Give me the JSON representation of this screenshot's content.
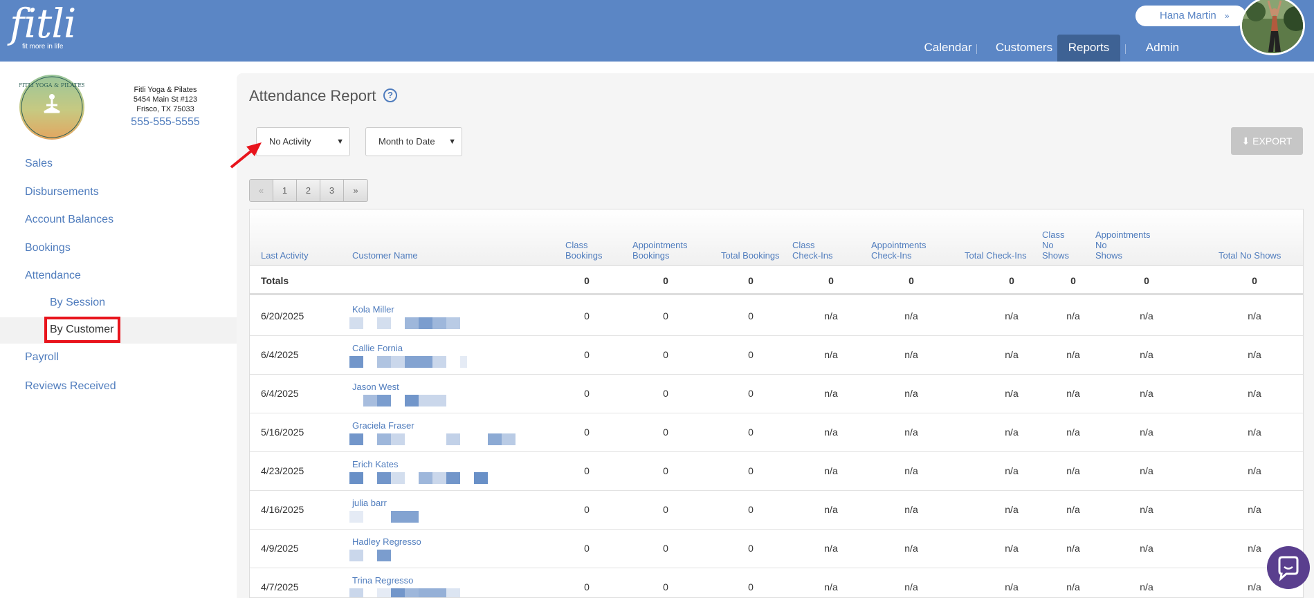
{
  "app": {
    "logo_text": "fitli",
    "logo_tagline": "fit more in life",
    "user_name": "Hana Martin",
    "user_chevron": "»"
  },
  "nav": {
    "items": [
      {
        "label": "Calendar"
      },
      {
        "label": "Customers"
      },
      {
        "label": "Reports",
        "active": true
      },
      {
        "label": "Admin"
      }
    ]
  },
  "studio": {
    "name": "Fitli Yoga & Pilates",
    "address1": "5454 Main St #123",
    "address2": "Frisco, TX 75033",
    "phone": "555-555-5555",
    "logo_text": "FITLI YOGA & PILATES"
  },
  "sidebar": {
    "items": [
      {
        "label": "Sales"
      },
      {
        "label": "Disbursements"
      },
      {
        "label": "Account Balances"
      },
      {
        "label": "Bookings"
      },
      {
        "label": "Attendance"
      },
      {
        "label": "Payroll"
      },
      {
        "label": "Reviews Received"
      }
    ],
    "subitems": [
      {
        "label": "By Session"
      },
      {
        "label": "By Customer",
        "active": true
      }
    ]
  },
  "report": {
    "title": "Attendance Report",
    "help_icon": "question-circle-icon",
    "filter_activity": "No Activity",
    "filter_range": "Month to Date",
    "export_label": "EXPORT",
    "pager": [
      "«",
      "1",
      "2",
      "3",
      "»"
    ]
  },
  "table": {
    "headers": [
      [
        "Last Activity"
      ],
      [
        "Customer Name"
      ],
      [
        "Class",
        "Bookings"
      ],
      [
        "Appointments",
        "Bookings"
      ],
      [
        "Total Bookings"
      ],
      [
        "Class",
        "Check-Ins"
      ],
      [
        "Appointments",
        "Check-Ins"
      ],
      [
        "Total Check-Ins"
      ],
      [
        "Class",
        "No",
        "Shows"
      ],
      [
        "Appointments",
        "No",
        "Shows"
      ],
      [
        "Total No Shows"
      ]
    ],
    "totals": {
      "label": "Totals",
      "values": [
        "0",
        "0",
        "0",
        "0",
        "0",
        "0",
        "0",
        "0",
        "0"
      ]
    },
    "rows": [
      {
        "date": "6/20/2025",
        "name": "Kola Miller",
        "values": [
          "0",
          "0",
          "0",
          "n/a",
          "n/a",
          "n/a",
          "n/a",
          "n/a",
          "n/a"
        ]
      },
      {
        "date": "6/4/2025",
        "name": "Callie Fornia",
        "values": [
          "0",
          "0",
          "0",
          "n/a",
          "n/a",
          "n/a",
          "n/a",
          "n/a",
          "n/a"
        ]
      },
      {
        "date": "6/4/2025",
        "name": "Jason West",
        "values": [
          "0",
          "0",
          "0",
          "n/a",
          "n/a",
          "n/a",
          "n/a",
          "n/a",
          "n/a"
        ]
      },
      {
        "date": "5/16/2025",
        "name": "Graciela Fraser",
        "values": [
          "0",
          "0",
          "0",
          "n/a",
          "n/a",
          "n/a",
          "n/a",
          "n/a",
          "n/a"
        ]
      },
      {
        "date": "4/23/2025",
        "name": "Erich Kates",
        "values": [
          "0",
          "0",
          "0",
          "n/a",
          "n/a",
          "n/a",
          "n/a",
          "n/a",
          "n/a"
        ]
      },
      {
        "date": "4/16/2025",
        "name": "julia barr",
        "values": [
          "0",
          "0",
          "0",
          "n/a",
          "n/a",
          "n/a",
          "n/a",
          "n/a",
          "n/a"
        ]
      },
      {
        "date": "4/9/2025",
        "name": "Hadley Regresso",
        "values": [
          "0",
          "0",
          "0",
          "n/a",
          "n/a",
          "n/a",
          "n/a",
          "n/a",
          "n/a"
        ]
      },
      {
        "date": "4/7/2025",
        "name": "Trina Regresso",
        "values": [
          "0",
          "0",
          "0",
          "n/a",
          "n/a",
          "n/a",
          "n/a",
          "n/a",
          "n/a"
        ]
      }
    ]
  },
  "colors": {
    "brand_blue": "#5b86c5",
    "link_blue": "#4f7cbd",
    "active_nav": "#3e6294",
    "highlight_red": "#e8141c",
    "chat_purple": "#5a3f8e"
  }
}
